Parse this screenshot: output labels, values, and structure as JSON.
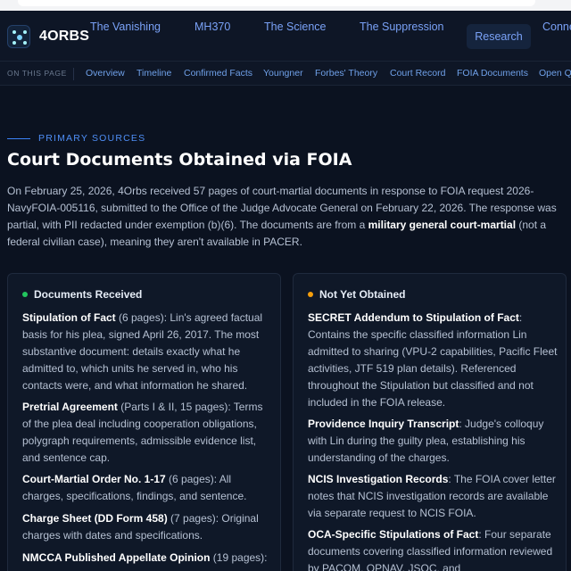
{
  "brand": {
    "name": "4ORBS"
  },
  "topnav": {
    "links": [
      "The Vanishing",
      "MH370",
      "The Science",
      "The Suppression",
      "Conne"
    ],
    "button": "Research"
  },
  "subnav": {
    "label": "ON THIS PAGE",
    "links": [
      "Overview",
      "Timeline",
      "Confirmed Facts",
      "Youngner",
      "Forbes' Theory",
      "Court Record",
      "FOIA Documents",
      "Open Q"
    ]
  },
  "section": {
    "eyebrow": "PRIMARY SOURCES",
    "title": "Court Documents Obtained via FOIA",
    "intro_before": "On February 25, 2026, 4Orbs received 57 pages of court-martial documents in response to FOIA request 2026-NavyFOIA-005116, submitted to the Office of the Judge Advocate General on February 22, 2026. The response was partial, with PII redacted under exemption (b)(6). The documents are from a ",
    "intro_bold": "military general court-martial",
    "intro_after": " (not a federal civilian case), meaning they aren't available in PACER."
  },
  "received": {
    "heading": "Documents Received",
    "dot_color": "#22c55e",
    "items": [
      {
        "name": "Stipulation of Fact",
        "meta": " (6 pages)",
        "desc": ": Lin's agreed factual basis for his plea, signed April 26, 2017. The most substantive document: details exactly what he admitted to, which units he served in, who his contacts were, and what information he shared."
      },
      {
        "name": "Pretrial Agreement",
        "meta": " (Parts I & II, 15 pages)",
        "desc": ": Terms of the plea deal including cooperation obligations, polygraph requirements, admissible evidence list, and sentence cap."
      },
      {
        "name": "Court-Martial Order No. 1-17",
        "meta": " (6 pages)",
        "desc": ": All charges, specifications, findings, and sentence."
      },
      {
        "name": "Charge Sheet (DD Form 458)",
        "meta": " (7 pages)",
        "desc": ": Original charges with dates and specifications."
      },
      {
        "name": "NMCCA Published Appellate Opinion",
        "meta": " (19 pages)",
        "desc": ":"
      }
    ]
  },
  "pending": {
    "heading": "Not Yet Obtained",
    "dot_color": "#f59e0b",
    "items": [
      {
        "name": "SECRET Addendum to Stipulation of Fact",
        "meta": "",
        "desc": ": Contains the specific classified information Lin admitted to sharing (VPU-2 capabilities, Pacific Fleet activities, JTF 519 plan details). Referenced throughout the Stipulation but classified and not included in the FOIA release."
      },
      {
        "name": "Providence Inquiry Transcript",
        "meta": "",
        "desc": ": Judge's colloquy with Lin during the guilty plea, establishing his understanding of the charges."
      },
      {
        "name": "NCIS Investigation Records",
        "meta": "",
        "desc": ": The FOIA cover letter notes that NCIS investigation records are available via separate request to NCIS FOIA."
      },
      {
        "name": "OCA-Specific Stipulations of Fact",
        "meta": "",
        "desc": ": Four separate documents covering classified information reviewed by PACOM, OPNAV, JSOC, and"
      }
    ]
  },
  "colors": {
    "background": "#0b1220",
    "accent": "#3b82f6",
    "link": "#7aa2f7"
  }
}
